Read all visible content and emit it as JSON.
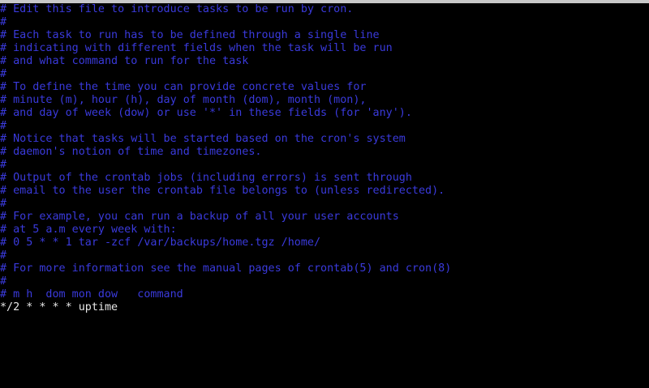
{
  "editor": {
    "comment_lines": [
      " Edit this file to introduce tasks to be run by cron.",
      "",
      " Each task to run has to be defined through a single line",
      " indicating with different fields when the task will be run",
      " and what command to run for the task",
      "",
      " To define the time you can provide concrete values for",
      " minute (m), hour (h), day of month (dom), month (mon),",
      " and day of week (dow) or use '*' in these fields (for 'any').",
      "",
      " Notice that tasks will be started based on the cron's system",
      " daemon's notion of time and timezones.",
      "",
      " Output of the crontab jobs (including errors) is sent through",
      " email to the user the crontab file belongs to (unless redirected).",
      "",
      " For example, you can run a backup of all your user accounts",
      " at 5 a.m every week with:",
      " 0 5 * * 1 tar -zcf /var/backups/home.tgz /home/",
      "",
      " For more information see the manual pages of crontab(5) and cron(8)",
      "",
      " m h  dom mon dow   command"
    ],
    "comment_prefix": "#",
    "cron_entry": "*/2 * * * * uptime"
  },
  "colors": {
    "background": "#000000",
    "comment": "#3a3adc",
    "text": "#e6e6e6",
    "title_bar": "#c8c8c8"
  }
}
